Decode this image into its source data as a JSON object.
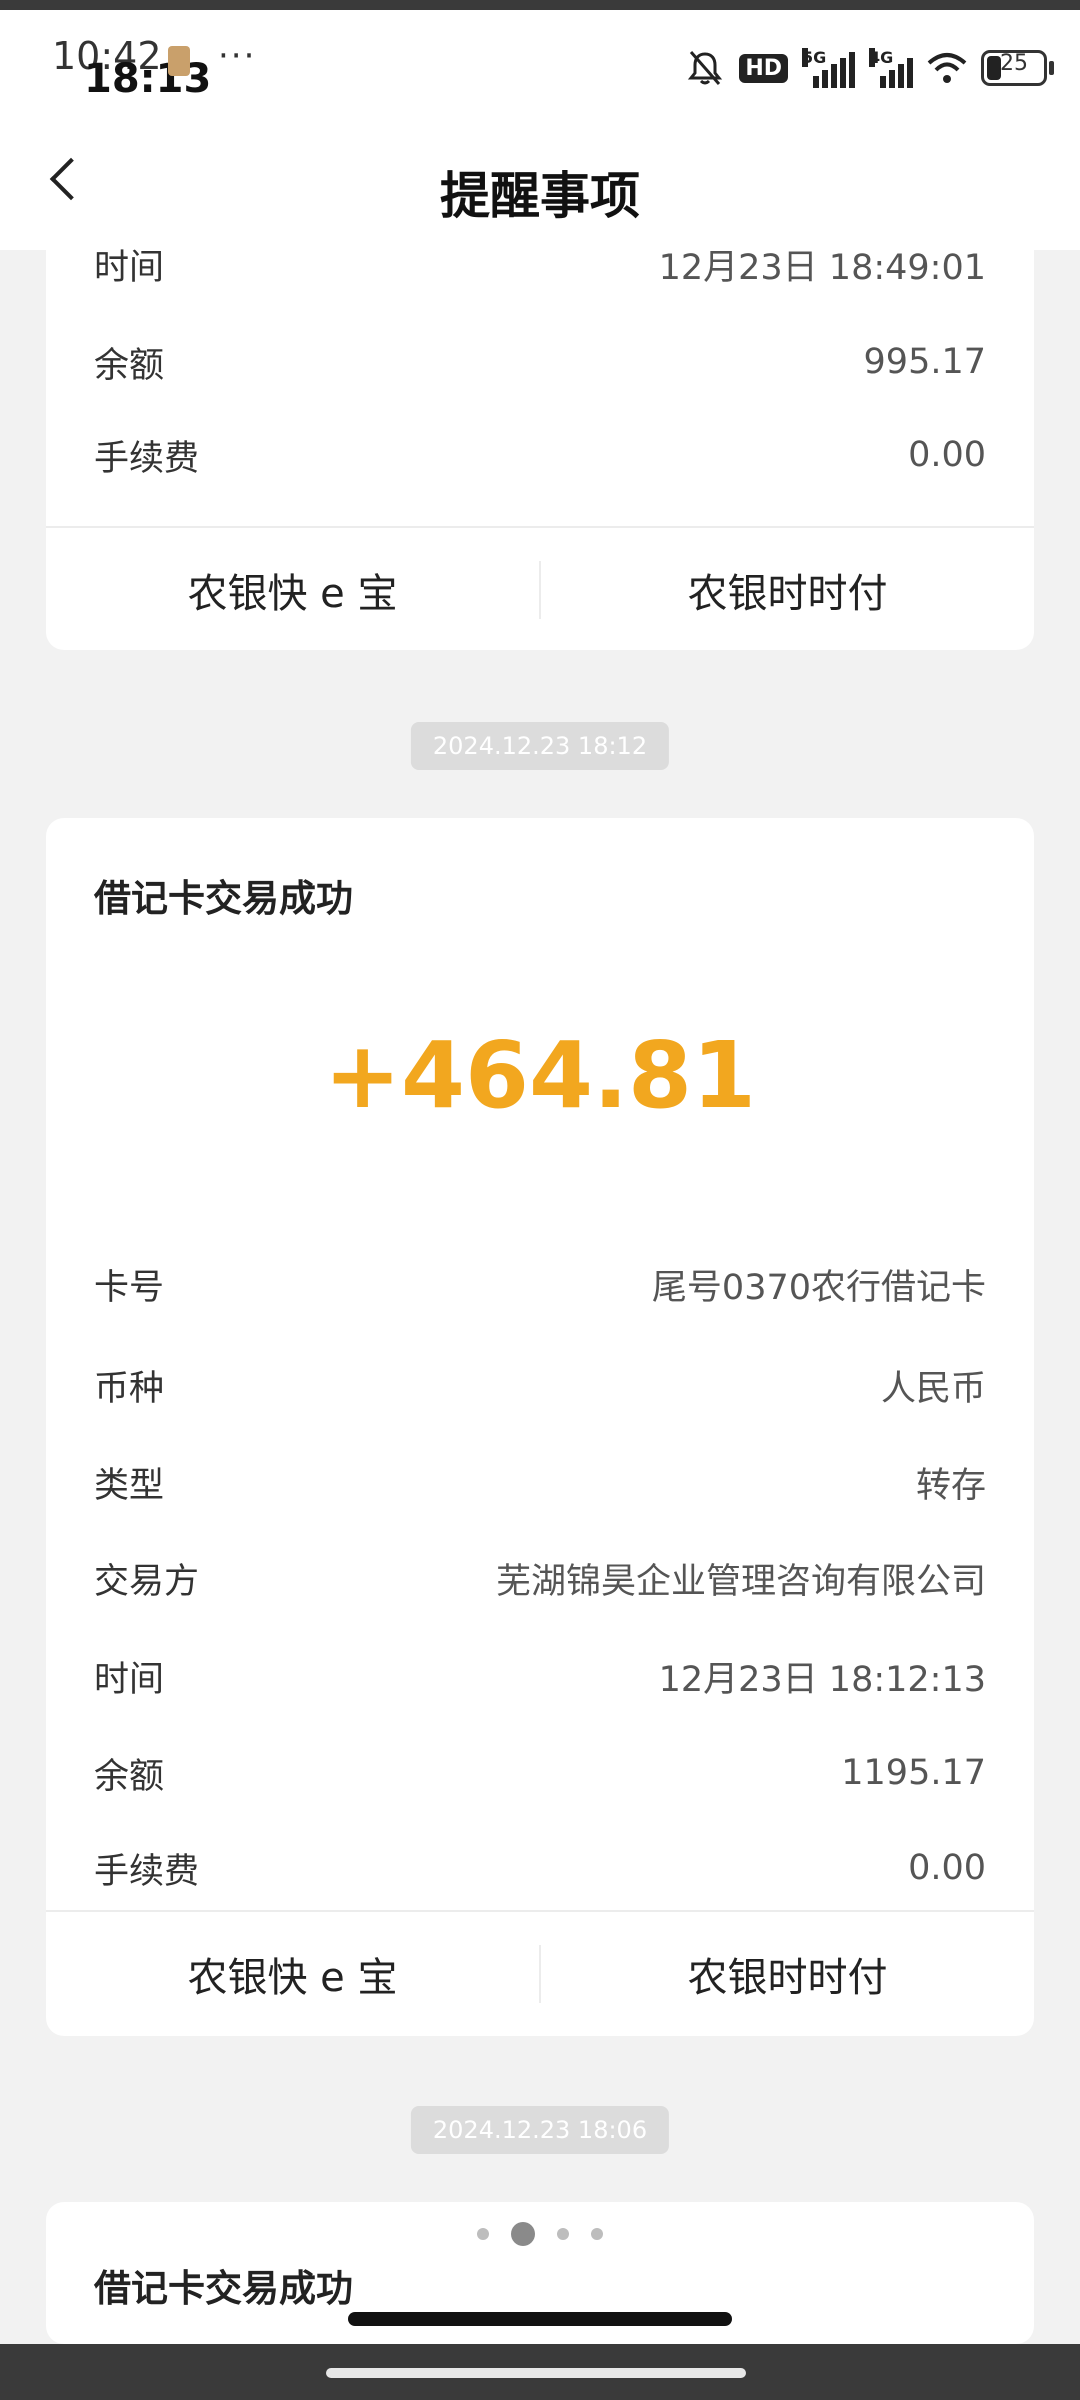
{
  "status_bar": {
    "time_back": "10:42",
    "time_front": "18:13",
    "dots": "···",
    "hd_label": "HD",
    "net1_label": "5G",
    "net2_label": "4G",
    "battery_level": "25"
  },
  "header": {
    "title": "提醒事项"
  },
  "card_top": {
    "rows": [
      {
        "label": "时间",
        "value": "12月23日 18:49:01"
      },
      {
        "label": "余额",
        "value": "995.17"
      },
      {
        "label": "手续费",
        "value": "0.00"
      }
    ],
    "actions": [
      "农银快 e 宝",
      "农银时时付"
    ]
  },
  "time_1": "2024.12.23 18:12",
  "card_main": {
    "title": "借记卡交易成功",
    "amount": "+464.81",
    "amount_color": "#f2a71f",
    "rows": [
      {
        "label": "卡号",
        "value": "尾号0370农行借记卡"
      },
      {
        "label": "币种",
        "value": "人民币"
      },
      {
        "label": "类型",
        "value": "转存"
      },
      {
        "label": "交易方",
        "value": "芜湖锦昊企业管理咨询有限公司"
      },
      {
        "label": "时间",
        "value": "12月23日 18:12:13"
      },
      {
        "label": "余额",
        "value": "1195.17"
      },
      {
        "label": "手续费",
        "value": "0.00"
      }
    ],
    "actions": [
      "农银快 e 宝",
      "农银时时付"
    ]
  },
  "time_2": "2024.12.23 18:06",
  "card_bottom": {
    "title": "借记卡交易成功"
  },
  "pager": {
    "count": 4,
    "active_index": 1
  }
}
